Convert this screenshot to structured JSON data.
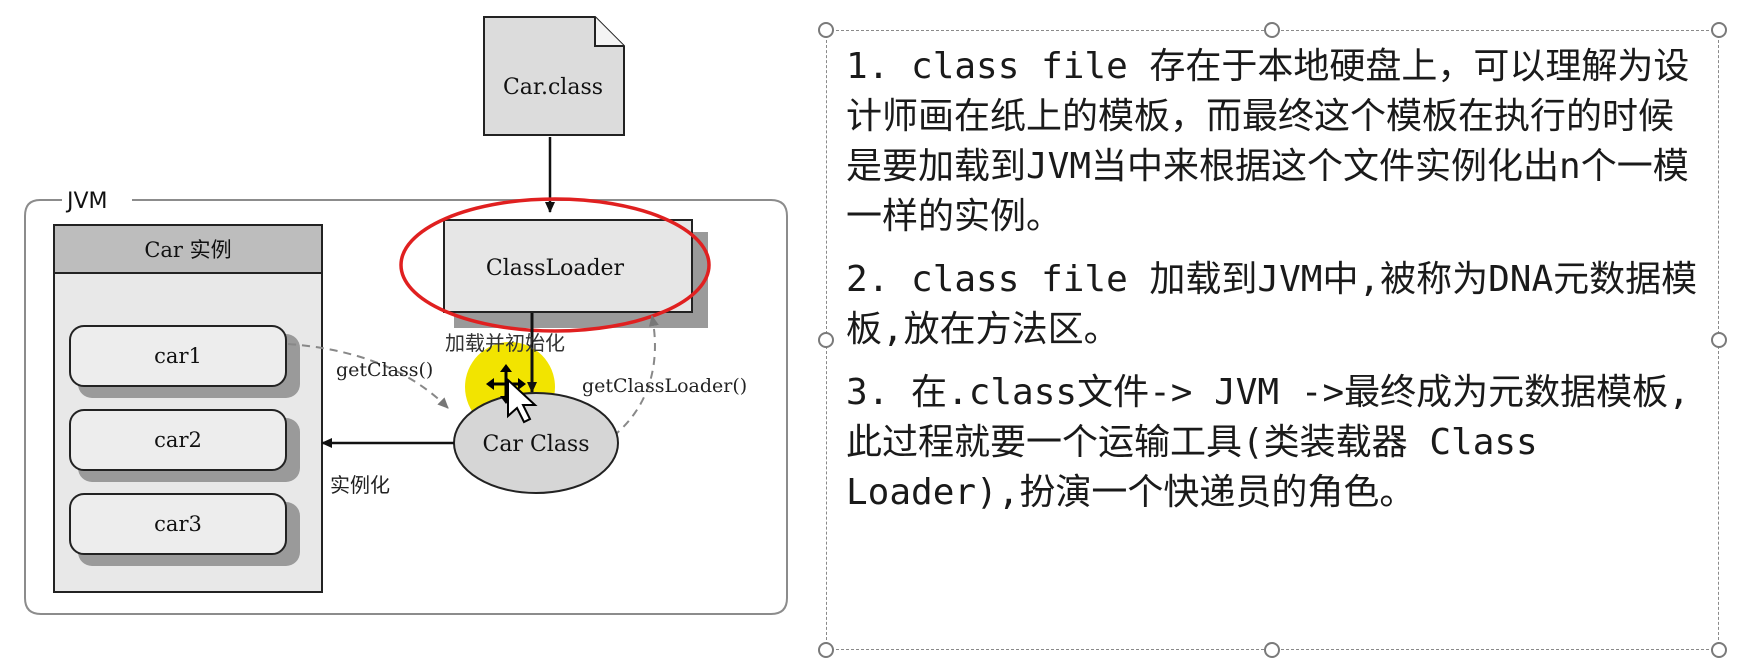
{
  "diagram": {
    "file_label": "Car.class",
    "jvm_label": "JVM",
    "instance_panel_title": "Car 实例",
    "instances": [
      "car1",
      "car2",
      "car3"
    ],
    "classloader_label": "ClassLoader",
    "carclass_label": "Car Class",
    "load_init_label": "加载并初始化",
    "get_class_label": "getClass()",
    "get_classloader_label": "getClassLoader()",
    "instantiate_label": "实例化",
    "colors": {
      "highlight_ellipse": "#e02020",
      "cursor_highlight": "#f2e400",
      "box_fill": "#e6e6e6",
      "header_fill": "#bdbdbd"
    }
  },
  "notes": {
    "items": [
      "1. class file 存在于本地硬盘上，可以理解为设计师画在纸上的模板，而最终这个模板在执行的时候是要加载到JVM当中来根据这个文件实例化出n个一模一样的实例。",
      "2. class file 加载到JVM中,被称为DNA元数据模板,放在方法区。",
      "3. 在.class文件-> JVM ->最终成为元数据模板,此过程就要一个运输工具(类装载器 Class Loader),扮演一个快递员的角色。"
    ]
  },
  "icons": [
    "move-cursor-icon",
    "pointer-cursor-icon"
  ]
}
